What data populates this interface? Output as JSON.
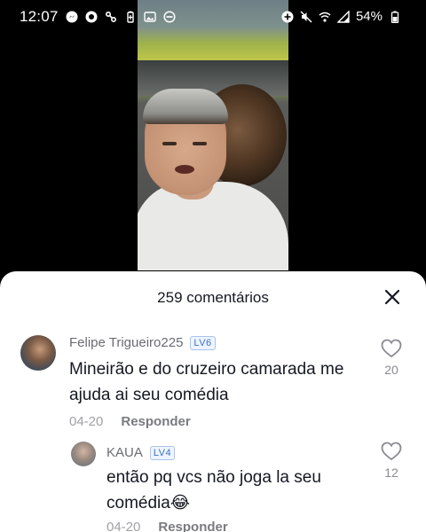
{
  "status_bar": {
    "time": "12:07",
    "battery_percent": "54%",
    "left_icons": [
      "messenger-icon",
      "target-icon",
      "link-icon",
      "battery-saver-icon",
      "image-icon",
      "blocked-icon"
    ],
    "right_icons": [
      "add-circle-icon",
      "mute-icon",
      "wifi-icon",
      "signal-icon",
      "battery-icon"
    ]
  },
  "sheet": {
    "title": "259 comentários",
    "close_icon": "close-icon"
  },
  "comments": [
    {
      "username": "Felipe Trigueiro225",
      "level": "LV6",
      "text": "Mineirão e do cruzeiro camarada me ajuda ai seu comédia",
      "date": "04-20",
      "reply_label": "Responder",
      "likes": "20"
    },
    {
      "username": "KAUA",
      "level": "LV4",
      "text": "então pq vcs não joga la seu comédia😂",
      "date": "04-20",
      "reply_label": "Responder",
      "likes": "12"
    }
  ],
  "colors": {
    "sheet_background": "#ffffff",
    "level_badge": "#3b73c6",
    "primary_text": "#161823",
    "secondary_text": "#6b6c72"
  }
}
